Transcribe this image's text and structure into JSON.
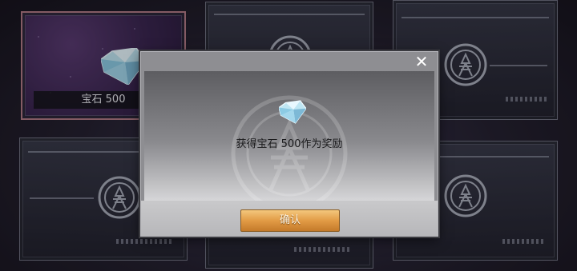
{
  "board": {
    "revealed_card": {
      "icon": "gem-icon",
      "label": "宝石 500"
    },
    "hidden_card_icon": "star-emblem-icon"
  },
  "dialog": {
    "close_icon": "close-icon",
    "close_glyph": "✕",
    "reward_icon": "gem-icon",
    "reward_text": "获得宝石 500作为奖励",
    "confirm_label": "确认"
  },
  "colors": {
    "confirm_button": "#e29b45",
    "revealed_card": "#3b2651"
  }
}
